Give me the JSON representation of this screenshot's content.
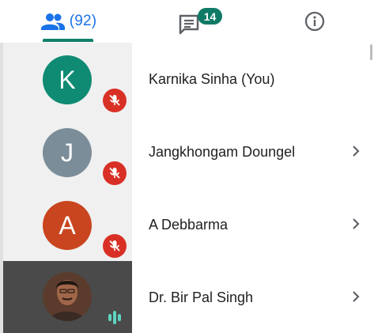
{
  "tabs": {
    "people": {
      "icon": "people-icon",
      "count": "(92)",
      "selected": true
    },
    "chat": {
      "icon": "chat-icon",
      "badge": "14"
    },
    "info": {
      "icon": "info-icon"
    }
  },
  "participants": [
    {
      "initial": "K",
      "name": "Karnika Sinha (You)",
      "avatar_color": "#0f8b73",
      "muted": true,
      "has_chevron": false
    },
    {
      "initial": "J",
      "name": "Jangkhongam Doungel",
      "avatar_color": "#7b8d99",
      "muted": true,
      "has_chevron": true
    },
    {
      "initial": "A",
      "name": "A Debbarma",
      "avatar_color": "#c9451f",
      "muted": true,
      "has_chevron": true
    },
    {
      "initial": "",
      "name": "Dr. Bir Pal Singh",
      "avatar_color": "#6b4b3a",
      "muted": false,
      "speaking": true,
      "has_chevron": true
    }
  ],
  "colors": {
    "accent": "#1a73e8",
    "tab_indicator": "#12806b",
    "mute_red": "#d93025",
    "speaking_teal": "#5fd3c0"
  }
}
